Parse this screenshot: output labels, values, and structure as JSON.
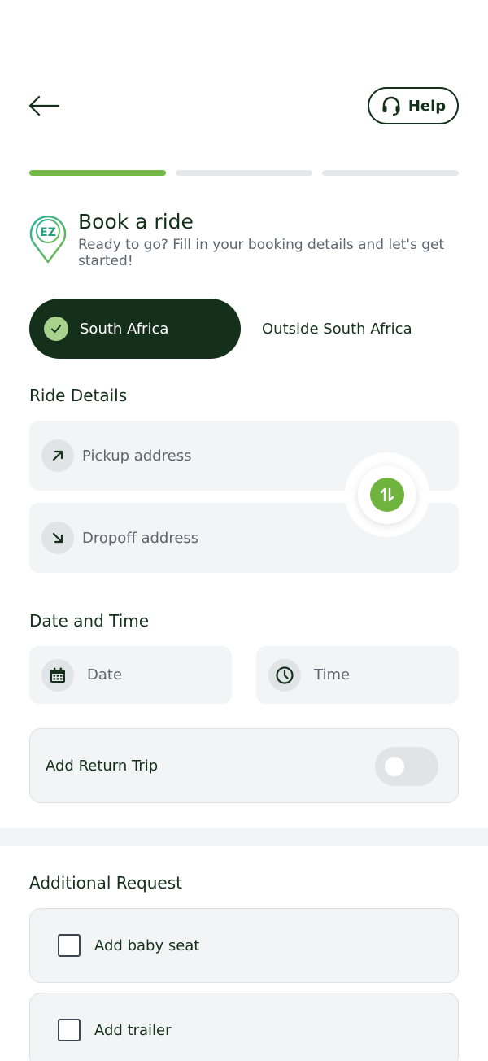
{
  "header": {
    "help_label": "Help"
  },
  "progress": {
    "steps": 3,
    "current_step": 1
  },
  "booking": {
    "title": "Book a ride",
    "subtitle": "Ready to go? Fill in your booking details and let's get started!"
  },
  "region": {
    "selected": "South Africa",
    "other": "Outside South Africa"
  },
  "ride_details": {
    "title": "Ride Details",
    "pickup_placeholder": "Pickup address",
    "dropoff_placeholder": "Dropoff address"
  },
  "date_time": {
    "title": "Date and Time",
    "date_placeholder": "Date",
    "time_placeholder": "Time"
  },
  "return_trip": {
    "label": "Add Return Trip",
    "enabled": false
  },
  "additional": {
    "title": "Additional Request",
    "options": [
      {
        "label": "Add baby seat",
        "checked": false
      },
      {
        "label": "Add trailer",
        "checked": false
      }
    ]
  },
  "colors": {
    "primary_dark": "#14301a",
    "accent_green": "#76b947",
    "field_bg": "#f2f4f5"
  },
  "icons": {
    "back": "arrow-left-icon",
    "help": "headset-icon",
    "logo": "ez-location-pin-logo",
    "check": "check-icon",
    "pickup": "arrow-up-right-icon",
    "dropoff": "arrow-down-right-icon",
    "swap": "swap-vertical-icon",
    "date": "calendar-icon",
    "time": "clock-icon"
  }
}
